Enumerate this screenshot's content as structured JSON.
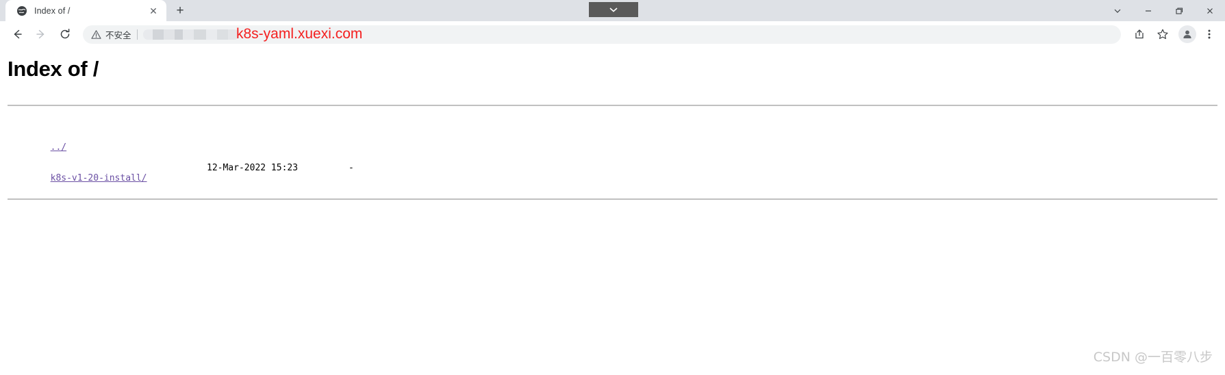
{
  "window": {
    "controls": [
      {
        "name": "chevron-down",
        "label": "⌄"
      },
      {
        "name": "minimize",
        "label": "—"
      },
      {
        "name": "maximize",
        "label": "❐"
      },
      {
        "name": "close",
        "label": "✕"
      }
    ]
  },
  "tabbar": {
    "tab": {
      "title": "Index of /",
      "favicon": "globe-icon",
      "close_label": "✕"
    },
    "new_tab_label": "+",
    "overlay": {
      "name": "chevron-down-icon",
      "background": "#5a5a5a"
    }
  },
  "toolbar": {
    "back_label": "←",
    "forward_label": "→",
    "reload_label": "⟳",
    "security": {
      "icon": "warning-triangle-icon",
      "text": "不安全"
    },
    "url_value": "",
    "url_placeholder": "",
    "annotation": {
      "text": "k8s-yaml.xuexi.com",
      "color": "#f41f1f"
    },
    "share_label": "share-icon",
    "bookmark_label": "star-icon",
    "profile_label": "person-icon",
    "menu_label": "three-dot-menu-icon"
  },
  "page": {
    "heading": "Index of /",
    "listing": [
      {
        "name": "../",
        "date": "",
        "size": ""
      },
      {
        "name": "k8s-v1-20-install/",
        "date": "12-Mar-2022 15:23",
        "size": "-"
      }
    ]
  },
  "watermark": {
    "text": "CSDN @一百零八步"
  }
}
